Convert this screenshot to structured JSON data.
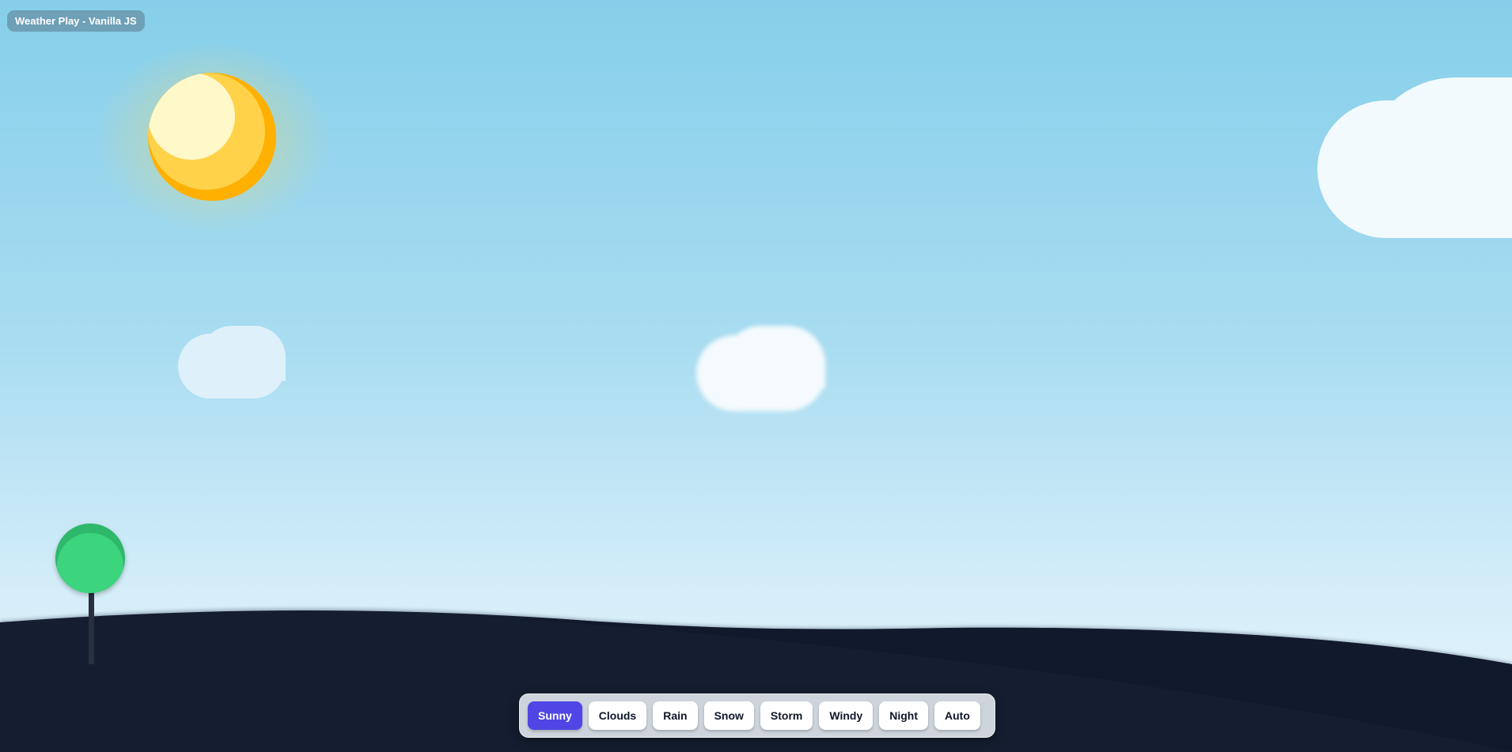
{
  "app": {
    "title": "Weather Play - Vanilla JS"
  },
  "scene": {
    "mode": "Sunny",
    "elements": {
      "sun": "sun-icon",
      "clouds": "cloud-icon",
      "tree": "tree-icon"
    },
    "colors": {
      "sky_top": "#86cfea",
      "sky_bottom": "#e6f5fc",
      "ground": "#141e30",
      "sun_outer": "#ffb000",
      "sun_mid": "#ffd24a",
      "sun_core": "#fff8c8",
      "tree_crown": "#3dd47e",
      "tree_trunk": "#2a2f3d"
    }
  },
  "toolbar": {
    "active": "Sunny",
    "active_color": "#4f46e5",
    "buttons": [
      {
        "label": "Sunny"
      },
      {
        "label": "Clouds"
      },
      {
        "label": "Rain"
      },
      {
        "label": "Snow"
      },
      {
        "label": "Storm"
      },
      {
        "label": "Windy"
      },
      {
        "label": "Night"
      },
      {
        "label": "Auto"
      }
    ]
  }
}
